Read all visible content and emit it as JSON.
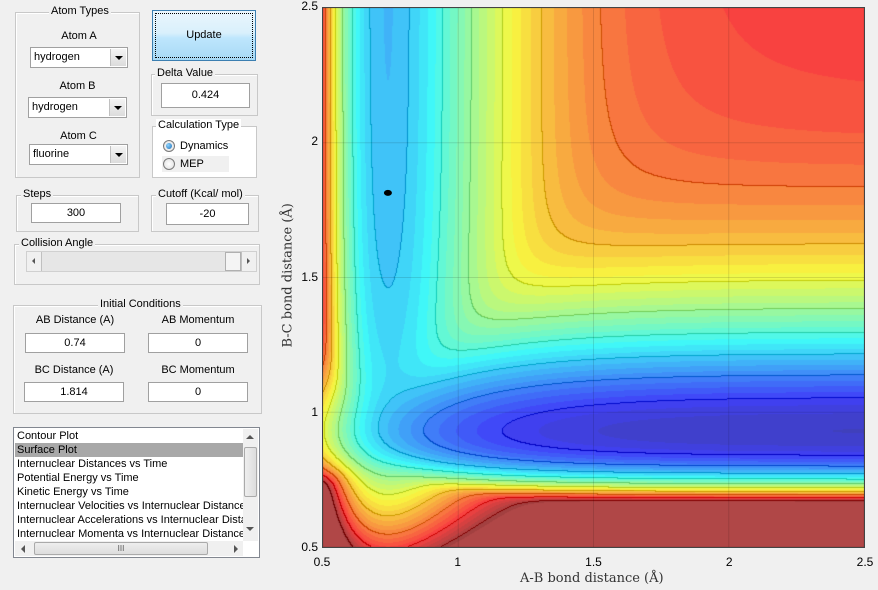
{
  "atom_types": {
    "title": "Atom Types",
    "atom_a": {
      "label": "Atom A",
      "value": "hydrogen"
    },
    "atom_b": {
      "label": "Atom B",
      "value": "hydrogen"
    },
    "atom_c": {
      "label": "Atom C",
      "value": "fluorine"
    }
  },
  "update_button": "Update",
  "delta": {
    "title": "Delta Value",
    "value": "0.424"
  },
  "calc_type": {
    "title": "Calculation Type",
    "options": [
      "Dynamics",
      "MEP"
    ],
    "selected": "Dynamics"
  },
  "steps": {
    "title": "Steps",
    "value": "300"
  },
  "cutoff": {
    "title": "Cutoff (Kcal/ mol)",
    "value": "-20"
  },
  "collision_angle": {
    "title": "Collision Angle",
    "slider_value_fraction": 1.0
  },
  "initial_conditions": {
    "title": "Initial Conditions",
    "ab_distance": {
      "label": "AB Distance (A)",
      "value": "0.74"
    },
    "ab_momentum": {
      "label": "AB Momentum",
      "value": "0"
    },
    "bc_distance": {
      "label": "BC Distance (A)",
      "value": "1.814"
    },
    "bc_momentum": {
      "label": "BC Momentum",
      "value": "0"
    }
  },
  "plot_list": {
    "items": [
      "Contour Plot",
      "Surface Plot",
      "Internuclear Distances vs Time",
      "Potential Energy vs Time",
      "Kinetic Energy vs Time",
      "Internuclear Velocities vs Internuclear Distance",
      "Internuclear Accelerations vs Internuclear Distance",
      "Internuclear Momenta vs Internuclear Distance"
    ],
    "selected": "Surface Plot",
    "hscroll_thumb": "III"
  },
  "chart_data": {
    "type": "contour",
    "xlabel": "A-B bond distance (Å)",
    "ylabel": "B-C bond distance (Å)",
    "xlim": [
      0.5,
      2.5
    ],
    "ylim": [
      0.5,
      2.5
    ],
    "xticks": [
      "0.5",
      "1",
      "1.5",
      "2",
      "2.5"
    ],
    "yticks": [
      "0.5",
      "1",
      "1.5",
      "2",
      "2.5"
    ],
    "grid": true,
    "colormap": "jet",
    "trajectory_point": {
      "x": 0.74,
      "y": 1.814
    }
  }
}
